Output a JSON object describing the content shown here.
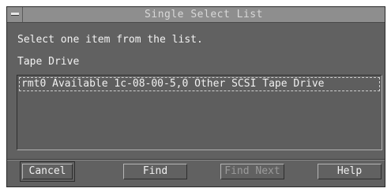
{
  "dialog": {
    "title": "Single Select List",
    "prompt": "Select one item from the list.",
    "list_label": "Tape Drive",
    "items": [
      {
        "label": "rmt0 Available 1c-08-00-5,0 Other SCSI Tape Drive",
        "selected": true
      }
    ],
    "buttons": {
      "cancel": "Cancel",
      "find": "Find",
      "find_next": "Find Next",
      "help": "Help"
    }
  },
  "icons": {
    "window_menu": "window-menu-icon"
  },
  "colors": {
    "dialog_background": "#616161",
    "titlebar_background": "#8e8e8e",
    "text": "#f2f2f2",
    "disabled_text": "#9a9a9a"
  }
}
